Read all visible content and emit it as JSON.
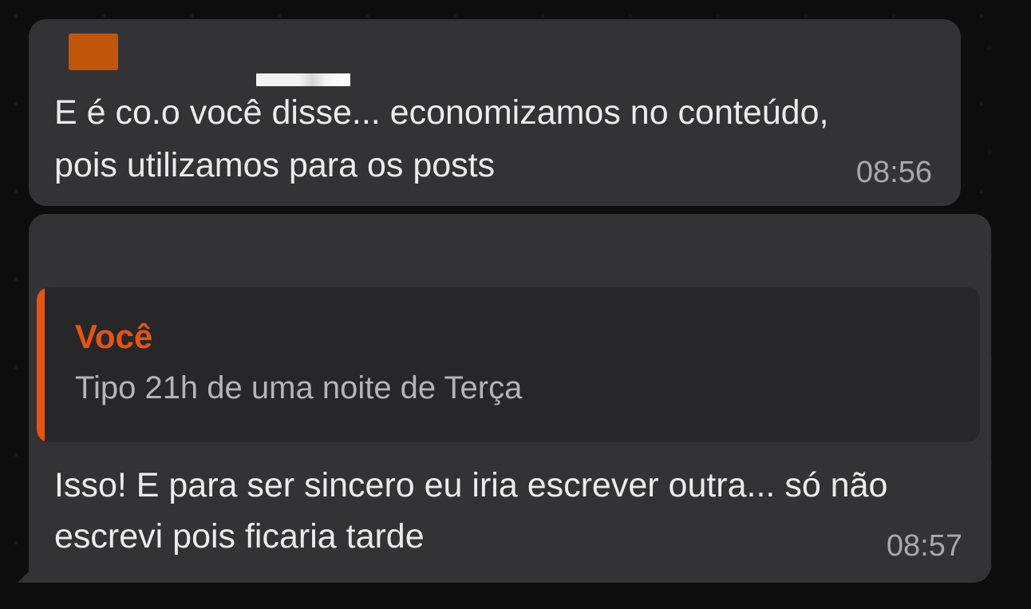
{
  "colors": {
    "bubble_bg": "#333335",
    "quote_bg": "#272729",
    "accent": "#e6550d",
    "avatar": "#c1560a",
    "text": "#ececec",
    "muted_text": "#b5b5b8",
    "timestamp": "#a9a9ad"
  },
  "messages": [
    {
      "text": "E é co.o você disse... economizamos no conteúdo, pois utilizamos para os posts",
      "time": "08:56",
      "sender_redacted": true
    },
    {
      "quote": {
        "author": "Você",
        "text": "Tipo 21h de uma noite de Terça"
      },
      "text": "Isso! E para ser sincero eu iria escrever outra... só não escrevi pois ficaria tarde",
      "time": "08:57"
    }
  ]
}
